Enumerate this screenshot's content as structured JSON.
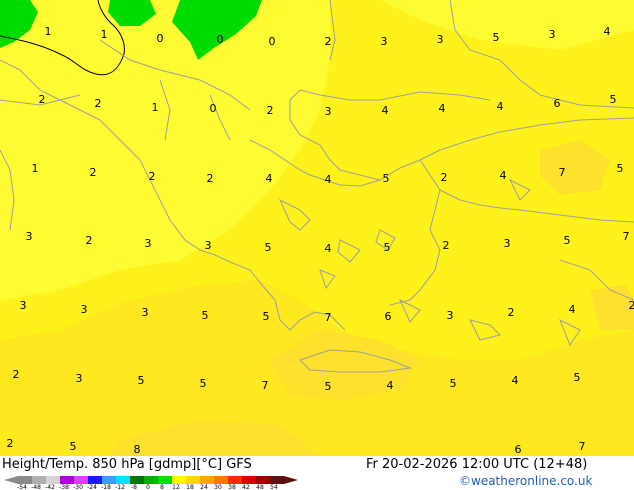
{
  "title": {
    "field": "Height/Temp. 850 hPa [gdmp][°C]",
    "model": "GFS",
    "valid": "Fr 20-02-2026 12:00 UTC (12+48)"
  },
  "credit": "©weatheronline.co.uk",
  "colors": {
    "yellow_light": "#fffb33",
    "yellow": "#fff21a",
    "yellow_deep": "#ffe81f",
    "orange_pale": "#fde12c",
    "green": "#00dc00",
    "coast": "#9e9e9e",
    "contour": "#000000"
  },
  "legend": {
    "ticks": [
      "-54",
      "-48",
      "-42",
      "-38",
      "-30",
      "-24",
      "-18",
      "-12",
      "-8",
      "0",
      "8",
      "12",
      "18",
      "24",
      "30",
      "38",
      "42",
      "48",
      "54"
    ],
    "colors": [
      "#8a8a8a",
      "#b0b0b0",
      "#d4d4d4",
      "#b000d8",
      "#e040ff",
      "#1a1aff",
      "#3aa0ff",
      "#00e0ff",
      "#007800",
      "#00b000",
      "#00e000",
      "#fff700",
      "#ffd700",
      "#ffa800",
      "#ff7800",
      "#ff2a00",
      "#d80000",
      "#a00000",
      "#601010"
    ]
  },
  "map_labels": [
    {
      "text": "1"
    },
    {
      "text": "1"
    },
    {
      "text": "0"
    },
    {
      "text": "0"
    },
    {
      "text": "0"
    },
    {
      "text": "2"
    },
    {
      "text": "3"
    },
    {
      "text": "3"
    },
    {
      "text": "5"
    },
    {
      "text": "3"
    },
    {
      "text": "4"
    },
    {
      "text": "2"
    },
    {
      "text": "2"
    },
    {
      "text": "1"
    },
    {
      "text": "0"
    },
    {
      "text": "2"
    },
    {
      "text": "3"
    },
    {
      "text": "4"
    },
    {
      "text": "4"
    },
    {
      "text": "4"
    },
    {
      "text": "6"
    },
    {
      "text": "5"
    },
    {
      "text": "1"
    },
    {
      "text": "2"
    },
    {
      "text": "2"
    },
    {
      "text": "2"
    },
    {
      "text": "4"
    },
    {
      "text": "4"
    },
    {
      "text": "5"
    },
    {
      "text": "2"
    },
    {
      "text": "4"
    },
    {
      "text": "7"
    },
    {
      "text": "5"
    },
    {
      "text": "3"
    },
    {
      "text": "2"
    },
    {
      "text": "3"
    },
    {
      "text": "3"
    },
    {
      "text": "5"
    },
    {
      "text": "4"
    },
    {
      "text": "5"
    },
    {
      "text": "2"
    },
    {
      "text": "3"
    },
    {
      "text": "5"
    },
    {
      "text": "7"
    },
    {
      "text": "3"
    },
    {
      "text": "3"
    },
    {
      "text": "3"
    },
    {
      "text": "5"
    },
    {
      "text": "5"
    },
    {
      "text": "7"
    },
    {
      "text": "6"
    },
    {
      "text": "3"
    },
    {
      "text": "2"
    },
    {
      "text": "4"
    },
    {
      "text": "2"
    },
    {
      "text": "2"
    },
    {
      "text": "3"
    },
    {
      "text": "5"
    },
    {
      "text": "5"
    },
    {
      "text": "7"
    },
    {
      "text": "5"
    },
    {
      "text": "4"
    },
    {
      "text": "5"
    },
    {
      "text": "4"
    },
    {
      "text": "5"
    },
    {
      "text": "2"
    },
    {
      "text": "5"
    },
    {
      "text": "8"
    },
    {
      "text": "6"
    },
    {
      "text": "7"
    }
  ]
}
